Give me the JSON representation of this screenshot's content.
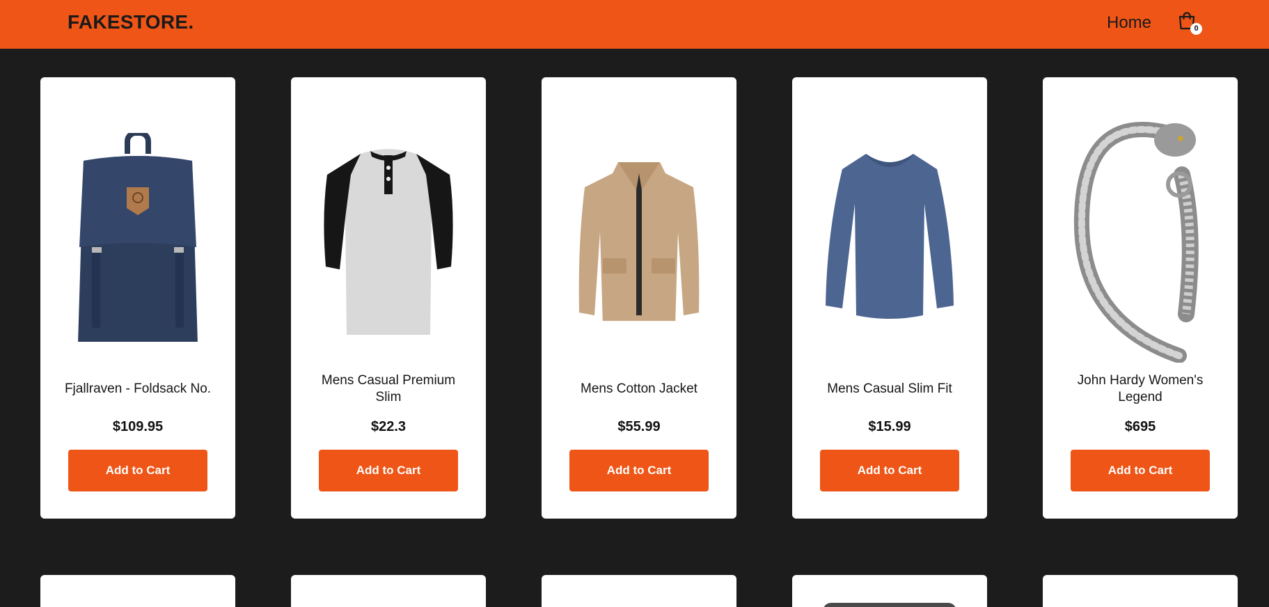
{
  "header": {
    "logo": "FAKESTORE.",
    "nav_home": "Home",
    "cart_count": "0",
    "cart_icon": "shopping-bag-icon"
  },
  "colors": {
    "accent": "#ee5516",
    "background": "#1c1c1c",
    "card": "#ffffff"
  },
  "products": [
    {
      "title": "Fjallraven - Foldsack No.",
      "price": "$109.95",
      "button": "Add to Cart",
      "image": "backpack-image"
    },
    {
      "title": "Mens Casual Premium Slim",
      "price": "$22.3",
      "button": "Add to Cart",
      "image": "raglan-tshirt-image"
    },
    {
      "title": "Mens Cotton Jacket",
      "price": "$55.99",
      "button": "Add to Cart",
      "image": "jacket-image"
    },
    {
      "title": "Mens Casual Slim Fit",
      "price": "$15.99",
      "button": "Add to Cart",
      "image": "longsleeve-shirt-image"
    },
    {
      "title": "John Hardy Women's Legend",
      "price": "$695",
      "button": "Add to Cart",
      "image": "dragon-bracelet-image"
    }
  ]
}
